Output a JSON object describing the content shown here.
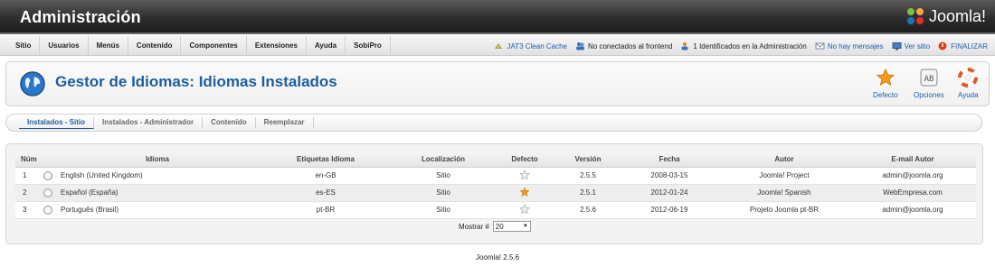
{
  "header": {
    "title": "Administración",
    "logo_text": "Joomla!"
  },
  "menu": {
    "items": [
      "Sitio",
      "Usuarios",
      "Menús",
      "Contenido",
      "Componentes",
      "Extensiones",
      "Ayuda",
      "SobiPro"
    ],
    "status": {
      "cache": "JAT3 Clean Cache",
      "frontend": "No conectados al frontend",
      "admin": "1 Identificados en la Administración",
      "messages": "No hay mensajes",
      "view_site": "Ver sitio",
      "logout": "FINALIZAR"
    }
  },
  "toolbar": {
    "title": "Gestor de Idiomas: Idiomas Instalados",
    "default_label": "Defecto",
    "options_label": "Opciones",
    "help_label": "Ayuda"
  },
  "subtabs": [
    "Instalados - Sitio",
    "Instalados - Administrador",
    "Contenido",
    "Reemplazar"
  ],
  "table": {
    "headers": [
      "Núm",
      "Idioma",
      "Etiquetas Idioma",
      "Localización",
      "Defecto",
      "Versión",
      "Fecha",
      "Autor",
      "E-mail Autor"
    ],
    "rows": [
      {
        "num": "1",
        "lang": "English (United Kingdom)",
        "tag": "en-GB",
        "location": "Sitio",
        "default": false,
        "version": "2.5.5",
        "date": "2008-03-15",
        "author": "Joomla! Project",
        "email": "admin@joomla.org"
      },
      {
        "num": "2",
        "lang": "Español (España)",
        "tag": "es-ES",
        "location": "Sitio",
        "default": true,
        "version": "2.5.1",
        "date": "2012-01-24",
        "author": "Joomla! Spanish",
        "email": "WebEmpresa.com"
      },
      {
        "num": "3",
        "lang": "Português (Brasil)",
        "tag": "pt-BR",
        "location": "Sitio",
        "default": false,
        "version": "2.5.6",
        "date": "2012-06-19",
        "author": "Projeto Joomla pt-BR",
        "email": "admin@joomla.org"
      }
    ]
  },
  "pagination": {
    "label": "Mostrar #",
    "value": "20"
  },
  "footer": {
    "version": "Joomla! 2.5.6"
  },
  "colors": {
    "title_blue": "#1d5e9e",
    "link_blue": "#1a5fae",
    "star_orange": "#f39a1d",
    "logout_red": "#d9431c"
  }
}
